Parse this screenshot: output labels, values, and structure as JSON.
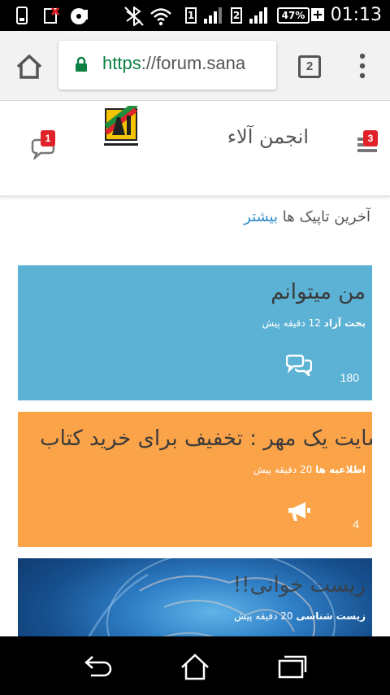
{
  "status_bar": {
    "time": "01:13",
    "battery_percent": "47%",
    "sim1": "1",
    "sim2": "2",
    "icons": [
      "phone-icon",
      "sim-off-icon",
      "media-icon",
      "bluetooth-off-icon",
      "wifi-icon",
      "signal-icon",
      "battery-icon"
    ]
  },
  "browser": {
    "url_scheme": "https",
    "url_rest": "://forum.sana",
    "tab_count": "2"
  },
  "site": {
    "title": "انجمن آلاء",
    "chat_badge": "1",
    "menu_badge": "3"
  },
  "latest": {
    "label": "آخرین تاپیک ها",
    "more_link": "بیشتر"
  },
  "topics": [
    {
      "title": "من میتوانم",
      "category": "بحث آزاد",
      "time": "12 دقیقه پیش",
      "count": "180",
      "icon": "comments-icon",
      "color": "#5bb2d4"
    },
    {
      "title": "سایت یک مهر : تخفیف برای خرید کتاب",
      "category": "اطلاعیه ها",
      "time": "20 دقیقه پیش",
      "count": "4",
      "icon": "megaphone-icon",
      "color": "#fba349"
    },
    {
      "title": "زیست خوانی!!",
      "category": "زیست شناسی",
      "time": "20 دقیقه پیش",
      "count": "",
      "icon": "",
      "color": "#1a5fa3"
    }
  ],
  "colors": {
    "accent_link": "#2e8bc9",
    "badge": "#e0232a",
    "secure_green": "#0b8043"
  }
}
